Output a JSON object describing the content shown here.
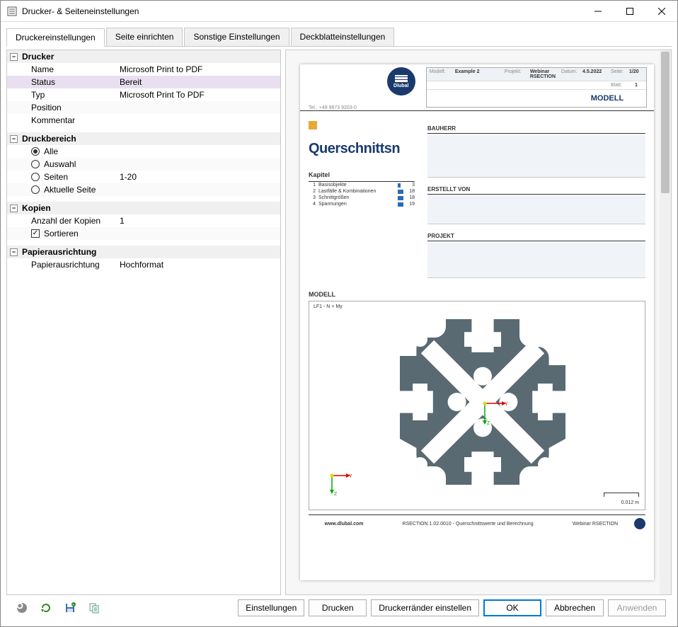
{
  "window": {
    "title": "Drucker- & Seiteneinstellungen"
  },
  "tabs": {
    "items": [
      {
        "label": "Druckereinstellungen",
        "active": true
      },
      {
        "label": "Seite einrichten",
        "active": false
      },
      {
        "label": "Sonstige Einstellungen",
        "active": false
      },
      {
        "label": "Deckblatteinstellungen",
        "active": false
      }
    ]
  },
  "groups": {
    "drucker": {
      "title": "Drucker",
      "rows": {
        "name": {
          "label": "Name",
          "value": "Microsoft Print to PDF"
        },
        "status": {
          "label": "Status",
          "value": "Bereit"
        },
        "typ": {
          "label": "Typ",
          "value": "Microsoft Print To PDF"
        },
        "position": {
          "label": "Position",
          "value": ""
        },
        "kommentar": {
          "label": "Kommentar",
          "value": ""
        }
      }
    },
    "druckbereich": {
      "title": "Druckbereich",
      "options": {
        "alle": {
          "label": "Alle",
          "checked": true
        },
        "auswahl": {
          "label": "Auswahl",
          "checked": false
        },
        "seiten": {
          "label": "Seiten",
          "checked": false,
          "value": "1-20"
        },
        "aktuell": {
          "label": "Aktuelle Seite",
          "checked": false
        }
      }
    },
    "kopien": {
      "title": "Kopien",
      "anzahl": {
        "label": "Anzahl der Kopien",
        "value": "1"
      },
      "sortieren": {
        "label": "Sortieren",
        "checked": true
      }
    },
    "papier": {
      "title": "Papierausrichtung",
      "row": {
        "label": "Papierausrichtung",
        "value": "Hochformat"
      }
    }
  },
  "preview": {
    "tel": "Tel.: +49 9673 9203-0",
    "logo_text": "Dlubal",
    "header": {
      "modell_l": "Modell:",
      "modell_v": "Example 2",
      "projekt_l": "Projekt:",
      "projekt_v": "Webinar RSECTION",
      "datum_l": "Datum:",
      "datum_v": "4.5.2022",
      "seite_l": "Seite:",
      "seite_v": "1/20",
      "blatt_l": "Blatt:",
      "blatt_v": "1",
      "modell_big": "MODELL"
    },
    "big_title": "Querschnittsn",
    "sections": {
      "bauherr": "BAUHERR",
      "erstellt": "ERSTELLT VON",
      "projekt": "PROJEKT",
      "modell": "MODELL"
    },
    "kapitel": {
      "title": "Kapitel",
      "rows": [
        {
          "n": "1",
          "t": "Basisobjekte",
          "p": "3"
        },
        {
          "n": "2",
          "t": "Lastfälle & Kombinationen",
          "p": "18"
        },
        {
          "n": "3",
          "t": "Schnittgrößen",
          "p": "18"
        },
        {
          "n": "4",
          "t": "Spannungen",
          "p": "19"
        }
      ]
    },
    "modellbox": {
      "lf": "LF1 - N + My",
      "scale": "0.012 m",
      "axis_y": "Y",
      "axis_z": "Z"
    },
    "footer": {
      "web": "www.dlubal.com",
      "mid": "RSECTION 1.02.0010 - Querschnittswerte und Berechnung",
      "right": "Webinar RSECTION"
    }
  },
  "buttons": {
    "einstellungen": "Einstellungen",
    "drucken": "Drucken",
    "raender": "Druckerränder einstellen",
    "ok": "OK",
    "abbrechen": "Abbrechen",
    "anwenden": "Anwenden"
  }
}
